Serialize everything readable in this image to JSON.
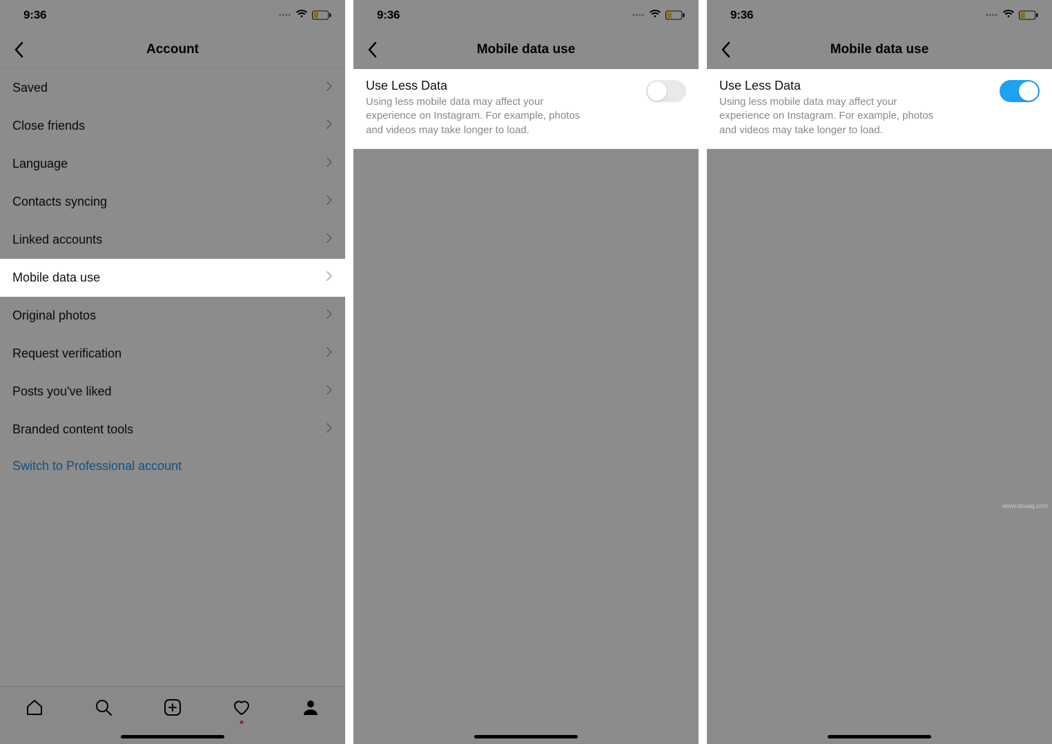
{
  "status": {
    "time": "9:36"
  },
  "screens": [
    {
      "title": "Account",
      "rows": [
        {
          "label": "Saved"
        },
        {
          "label": "Close friends"
        },
        {
          "label": "Language"
        },
        {
          "label": "Contacts syncing"
        },
        {
          "label": "Linked accounts"
        },
        {
          "label": "Mobile data use"
        },
        {
          "label": "Original photos"
        },
        {
          "label": "Request verification"
        },
        {
          "label": "Posts you've liked"
        },
        {
          "label": "Branded content tools"
        }
      ],
      "link": "Switch to Professional account",
      "highlighted_index": 5
    },
    {
      "title": "Mobile data use",
      "setting": {
        "title": "Use Less Data",
        "desc": "Using less mobile data may affect your experience on Instagram. For example, photos and videos may take longer to load.",
        "on": false
      }
    },
    {
      "title": "Mobile data use",
      "setting": {
        "title": "Use Less Data",
        "desc": "Using less mobile data may affect your experience on Instagram. For example, photos and videos may take longer to load.",
        "on": true
      }
    }
  ],
  "watermark": "www.deuaq.com"
}
